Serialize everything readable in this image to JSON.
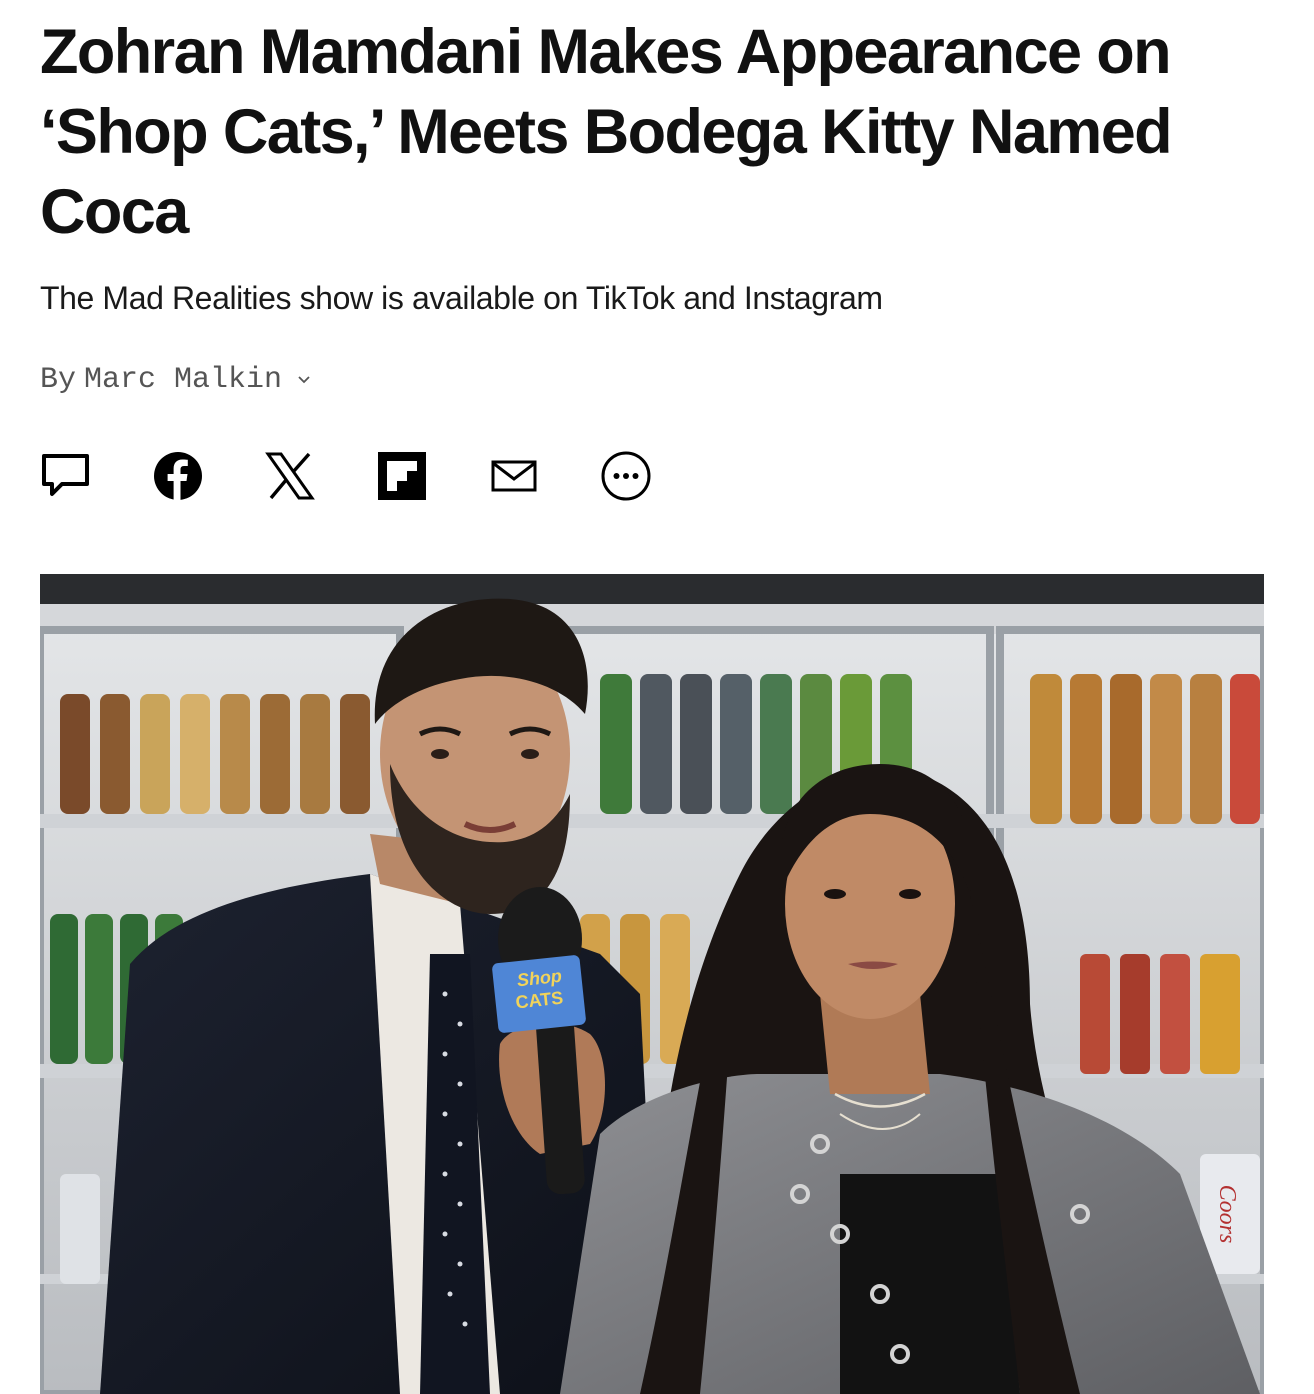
{
  "article": {
    "headline": "Zohran Mamdani Makes Appearance on ‘Shop Cats,’ Meets Bodega Kitty Named Coca",
    "dek": "The Mad Realities show is available on TikTok and Instagram",
    "byline": {
      "prefix": "By",
      "author": "Marc Malkin"
    }
  },
  "share_bar": {
    "items": [
      {
        "name": "comments",
        "icon": "comment-icon"
      },
      {
        "name": "facebook",
        "icon": "facebook-icon"
      },
      {
        "name": "x",
        "icon": "x-icon"
      },
      {
        "name": "flipboard",
        "icon": "flipboard-icon"
      },
      {
        "name": "email",
        "icon": "email-icon"
      },
      {
        "name": "more",
        "icon": "more-icon"
      }
    ]
  },
  "hero_image": {
    "mic_flag_text_line1": "Shop",
    "mic_flag_text_line2": "CATS",
    "can_text": "Coors"
  }
}
